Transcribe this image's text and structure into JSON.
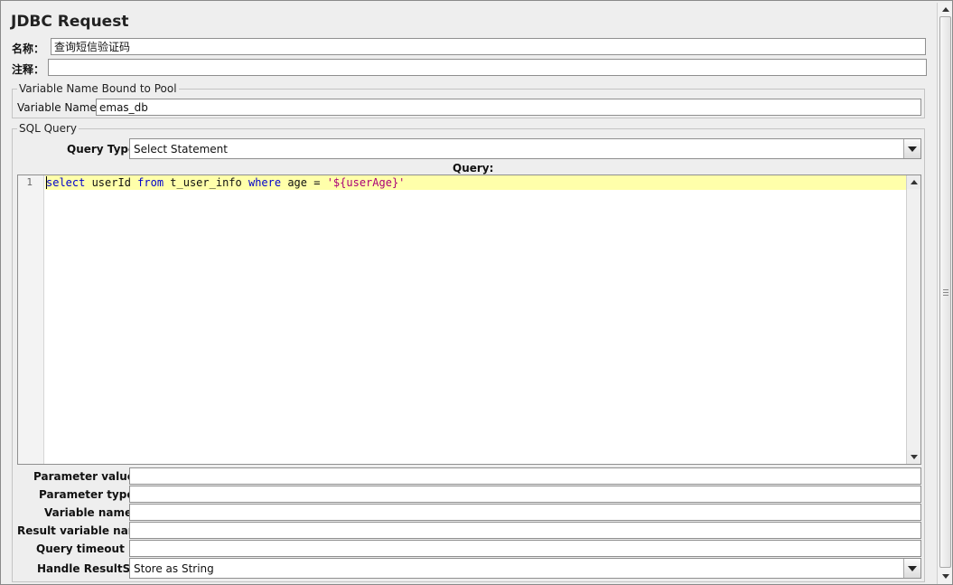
{
  "header": {
    "title": "JDBC Request"
  },
  "name_row": {
    "label": "名称：",
    "value": "查询短信验证码"
  },
  "comment_row": {
    "label": "注释：",
    "value": ""
  },
  "pool_group": {
    "legend": "Variable Name Bound to Pool",
    "var_label": "Variable Name:",
    "var_value": "emas_db"
  },
  "sql_group": {
    "legend": "SQL Query",
    "query_type_label": "Query Type:",
    "query_type_value": "Select Statement",
    "query_label": "Query:",
    "line_number": "1",
    "code": {
      "kw_select": "select",
      "t1": " userId ",
      "kw_from": "from",
      "t2": " t_user_info ",
      "kw_where": "where",
      "t3": " age = ",
      "q1": "'",
      "str_param": "${userAge}",
      "q2": "'"
    }
  },
  "params": {
    "parameter_values_label": "Parameter values:",
    "parameter_values": "",
    "parameter_types_label": "Parameter types:",
    "parameter_types": "",
    "variable_names_label": "Variable names:",
    "variable_names": "",
    "result_variable_label": "Result variable name:",
    "result_variable": "",
    "query_timeout_label": "Query timeout (s):",
    "query_timeout": "",
    "handle_resultset_label": "Handle ResultSet:",
    "handle_resultset_value": "Store as String"
  },
  "icons": {
    "dropdown": "chevron-down-icon",
    "scroll_up": "arrow-up-icon",
    "scroll_down": "arrow-down-icon"
  }
}
